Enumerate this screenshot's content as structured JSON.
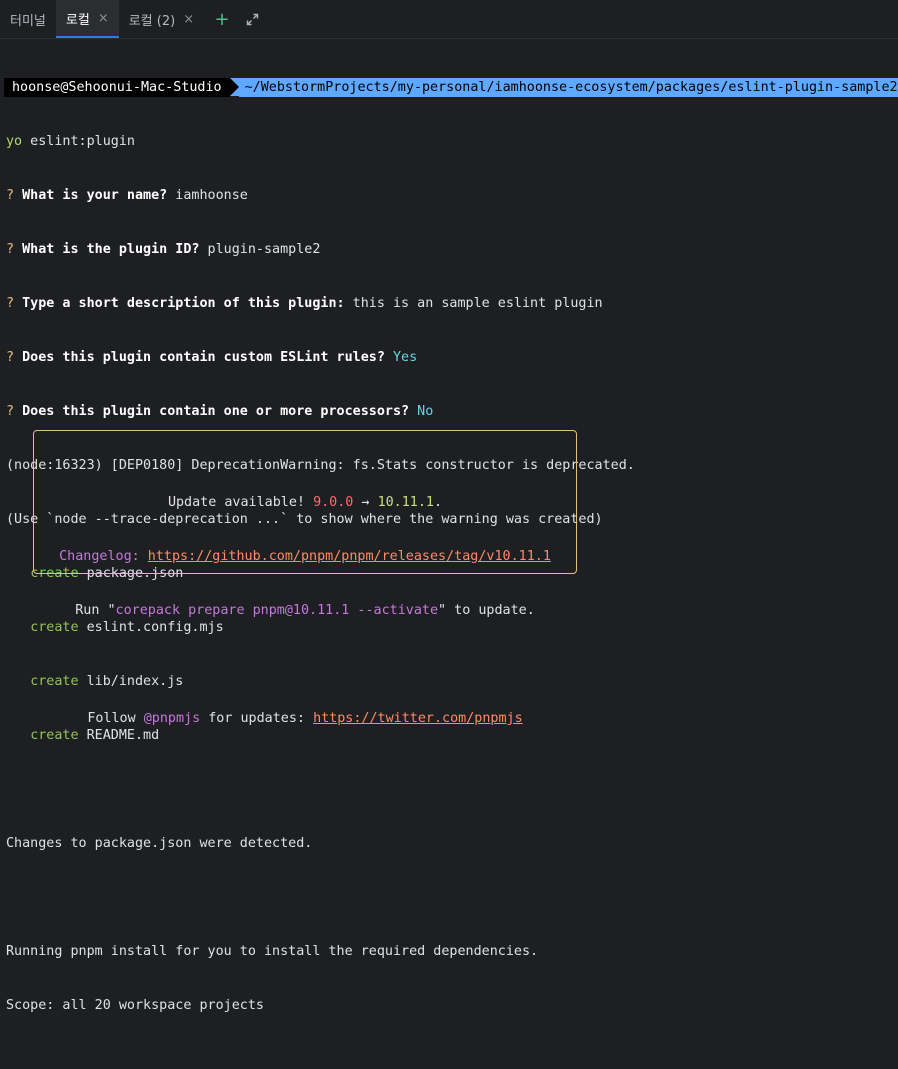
{
  "tabs": [
    {
      "label": "터미널"
    },
    {
      "label": "로컬"
    },
    {
      "label": "로컬 (2)"
    }
  ],
  "close_glyph": "×",
  "plus_glyph": "+",
  "prompt": {
    "user": "hoonse@Sehoonui-Mac-Studio",
    "path": "~/WebstormProjects/my-personal/iamhoonse-ecosystem/packages/eslint-plugin-sample2"
  },
  "lines": {
    "l1_yo": "yo",
    "l1_cmd": " eslint:plugin",
    "q_mark": "?",
    "q1_label": " What is your name?",
    "q1_answer": " iamhoonse",
    "q2_label": " What is the plugin ID?",
    "q2_answer": " plugin-sample2",
    "q3_label": " Type a short description of this plugin:",
    "q3_answer": " this is an sample eslint plugin",
    "q4_label": " Does this plugin contain custom ESLint rules?",
    "q4_answer": " Yes",
    "q5_label": " Does this plugin contain one or more processors?",
    "q5_answer": " No",
    "warn1": "(node:16323) [DEP0180] DeprecationWarning: fs.Stats constructor is deprecated.",
    "warn2": "(Use `node --trace-deprecation ...` to show where the warning was created)",
    "create_word": "create",
    "files": [
      "package.json",
      "eslint.config.mjs",
      "lib/index.js",
      "README.md"
    ],
    "changes": "Changes to package.json were detected.",
    "running": "Running pnpm install for you to install the required dependencies.",
    "scope": "Scope: all 20 workspace projects"
  },
  "update_box": {
    "update_prefix": "Update available! ",
    "old_version": "9.0.0",
    "arrow": " → ",
    "new_version": "10.11.1",
    "period": ".",
    "changelog_label": "Changelog:",
    "changelog_url": "https://github.com/pnpm/pnpm/releases/tag/v10.11.1",
    "run_prefix": "Run \"",
    "run_cmd": "corepack prepare pnpm@10.11.1 --activate",
    "run_suffix": "\" to update.",
    "follow_prefix": "Follow ",
    "follow_handle": "@pnpmjs",
    "follow_mid": " for updates: ",
    "twitter_url": "https://twitter.com/pnpmjs"
  },
  "colors": {
    "background": "#1e1f22",
    "prompt_path_bg": "#5fa8ff",
    "box_border": "#e5c07b",
    "accent_plus": "#4fbf86"
  }
}
